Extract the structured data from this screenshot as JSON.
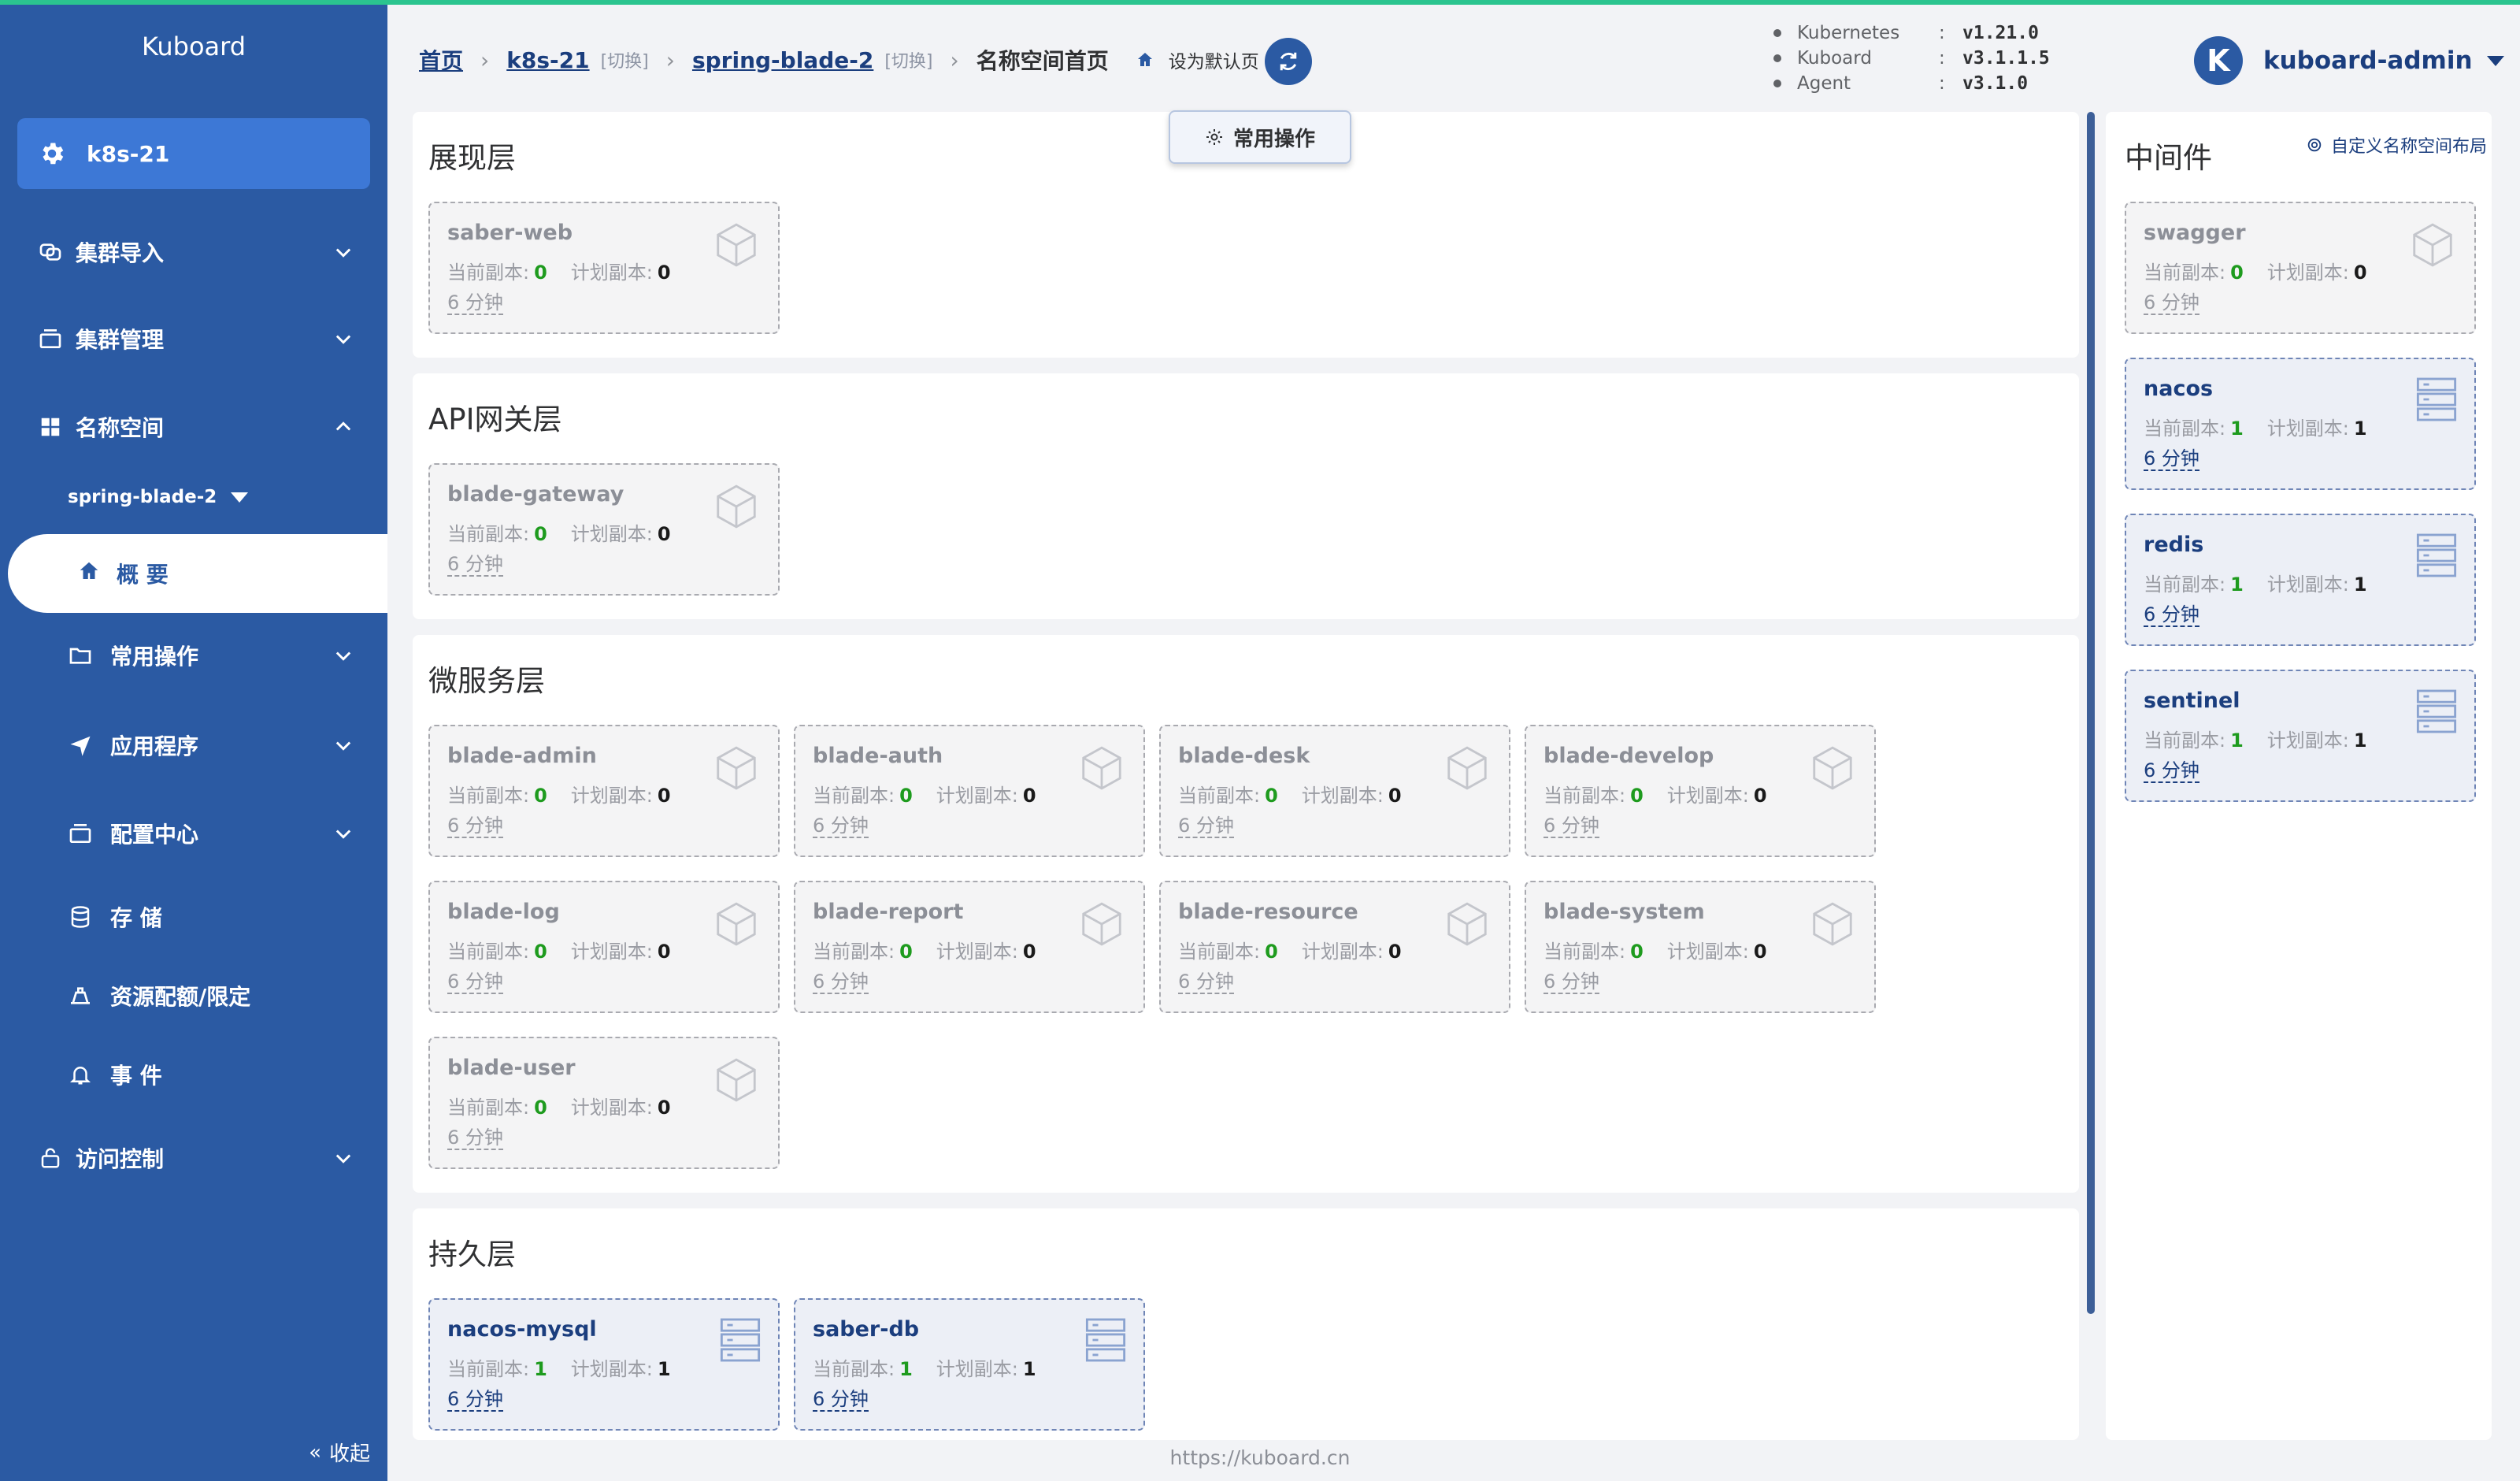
{
  "colors": {
    "sidebar": "#2b5aa3",
    "accent_green": "#2bc48f",
    "replica_green": "#1e9b1e",
    "link": "#1b3e7e"
  },
  "sidebar": {
    "logo": "Kuboard",
    "cluster": "k8s-21",
    "menu": {
      "cluster_import": "集群导入",
      "cluster_manage": "集群管理",
      "namespace": "名称空间",
      "ns_selected": "spring-blade-2",
      "overview": "概 要",
      "common_ops": "常用操作",
      "apps": "应用程序",
      "config_center": "配置中心",
      "storage": "存 储",
      "quota": "资源配额/限定",
      "events": "事 件",
      "access_control": "访问控制"
    },
    "collapse": "收起"
  },
  "header": {
    "home": "首页",
    "cluster": "k8s-21",
    "switch": "[切换]",
    "namespace": "spring-blade-2",
    "current": "名称空间首页",
    "set_default": "设为默认页",
    "versions": [
      {
        "name": "Kubernetes",
        "value": "v1.21.0"
      },
      {
        "name": "Kuboard",
        "value": "v3.1.1.5"
      },
      {
        "name": "Agent",
        "value": "v3.1.0"
      }
    ],
    "user_initial": "K",
    "user": "kuboard-admin"
  },
  "common_ops_button": "常用操作",
  "labels": {
    "current_replicas": "当前副本:",
    "planned_replicas": "计划副本:"
  },
  "sections": {
    "presentation": {
      "title": "展现层",
      "cards": [
        {
          "name": "saber-web",
          "current": "0",
          "planned": "0",
          "age": "6 分钟"
        }
      ]
    },
    "gateway": {
      "title": "API网关层",
      "cards": [
        {
          "name": "blade-gateway",
          "current": "0",
          "planned": "0",
          "age": "6 分钟"
        }
      ]
    },
    "microservice": {
      "title": "微服务层",
      "cards": [
        {
          "name": "blade-admin",
          "current": "0",
          "planned": "0",
          "age": "6 分钟"
        },
        {
          "name": "blade-auth",
          "current": "0",
          "planned": "0",
          "age": "6 分钟"
        },
        {
          "name": "blade-desk",
          "current": "0",
          "planned": "0",
          "age": "6 分钟"
        },
        {
          "name": "blade-develop",
          "current": "0",
          "planned": "0",
          "age": "6 分钟"
        },
        {
          "name": "blade-log",
          "current": "0",
          "planned": "0",
          "age": "6 分钟"
        },
        {
          "name": "blade-report",
          "current": "0",
          "planned": "0",
          "age": "6 分钟"
        },
        {
          "name": "blade-resource",
          "current": "0",
          "planned": "0",
          "age": "6 分钟"
        },
        {
          "name": "blade-system",
          "current": "0",
          "planned": "0",
          "age": "6 分钟"
        },
        {
          "name": "blade-user",
          "current": "0",
          "planned": "0",
          "age": "6 分钟"
        }
      ]
    },
    "persistence": {
      "title": "持久层",
      "cards": [
        {
          "name": "nacos-mysql",
          "current": "1",
          "planned": "1",
          "age": "6 分钟"
        },
        {
          "name": "saber-db",
          "current": "1",
          "planned": "1",
          "age": "6 分钟"
        }
      ]
    },
    "middleware": {
      "title": "中间件",
      "customize": "自定义名称空间布局",
      "cards": [
        {
          "name": "swagger",
          "current": "0",
          "planned": "0",
          "age": "6 分钟"
        },
        {
          "name": "nacos",
          "current": "1",
          "planned": "1",
          "age": "6 分钟"
        },
        {
          "name": "redis",
          "current": "1",
          "planned": "1",
          "age": "6 分钟"
        },
        {
          "name": "sentinel",
          "current": "1",
          "planned": "1",
          "age": "6 分钟"
        }
      ]
    }
  },
  "footer": "https://kuboard.cn"
}
